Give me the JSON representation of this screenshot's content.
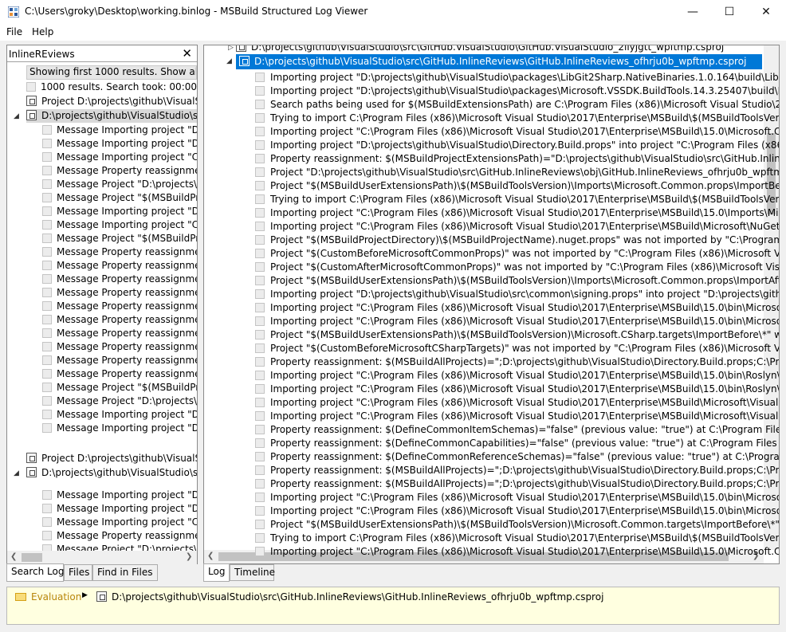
{
  "window": {
    "title": "C:\\Users\\groky\\Desktop\\working.binlog - MSBuild Structured Log Viewer",
    "minimize": "—",
    "maximize": "☐",
    "close": "✕"
  },
  "menu": {
    "file": "File",
    "help": "Help"
  },
  "search": {
    "value": "InlineREviews",
    "clear": "✕"
  },
  "left_tree": {
    "banner": "Showing first 1000 results. Show all results instead (slow).",
    "result_count": "1000 results. Search took: 00:00:00.0070000",
    "project_1": "Project D:\\projects\\github\\VisualStudio\\src\\GitHub.InlineReviews\\GitHub.InlineReviews.csproj",
    "folder_1": "D:\\projects\\github\\VisualStudio\\src\\GitHub.InlineReviews\\GitHub.InlineReviews_ofhrju0b_wpftmp.csproj",
    "messages_1": [
      "Message Importing project \"D",
      "Message Importing project \"D",
      "Message Importing project \"C",
      "Message Property reassignme",
      "Message Project \"D:\\projects\\",
      "Message Project \"$(MSBuildPr",
      "Message Importing project \"D",
      "Message Importing project \"C",
      "Message Project \"$(MSBuildPr",
      "Message Property reassignme",
      "Message Property reassignme",
      "Message Property reassignme",
      "Message Property reassignme",
      "Message Property reassignme",
      "Message Property reassignme",
      "Message Property reassignme",
      "Message Property reassignme",
      "Message Property reassignme",
      "Message Property reassignme",
      "Message Project \"$(MSBuildPr",
      "Message Project \"D:\\projects\\",
      "Message Importing project \"D",
      "Message Importing project \"D"
    ],
    "project_2": "Project D:\\projects\\github\\VisualStudio\\src\\GitHub.InlineReviews\\GitHub.InlineReviews.csproj",
    "folder_2": "D:\\projects\\github\\VisualStudio\\src\\GitHub.InlineReviews\\GitHub.InlineReviews_ofhrju0b_wpftmp.csproj",
    "messages_2": [
      "Message Importing project \"D",
      "Message Importing project \"D",
      "Message Importing project \"C",
      "Message Property reassignme",
      "Message Project \"D:\\projects\\"
    ]
  },
  "left_tabs": [
    "Search Log",
    "Files",
    "Find in Files"
  ],
  "right_tree": {
    "top_partial": "D:\\projects\\github\\VisualStudio\\src\\GitHub.VisualStudio\\GitHub.VisualStudio_2ilyjgtt_wpftmp.csproj",
    "selected_project": "D:\\projects\\github\\VisualStudio\\src\\GitHub.InlineReviews\\GitHub.InlineReviews_ofhrju0b_wpftmp.csproj",
    "rows": [
      "Importing project \"D:\\projects\\github\\VisualStudio\\packages\\LibGit2Sharp.NativeBinaries.1.0.164\\build\\LibGit2Sharp.",
      "Importing project \"D:\\projects\\github\\VisualStudio\\packages\\Microsoft.VSSDK.BuildTools.14.3.25407\\build\\Microsoft",
      "Search paths being used for $(MSBuildExtensionsPath) are C:\\Program Files (x86)\\Microsoft Visual Studio\\2017\\Enterp",
      "Trying to import C:\\Program Files (x86)\\Microsoft Visual Studio\\2017\\Enterprise\\MSBuild\\$(MSBuildToolsVersion)\\Mic",
      "Importing project \"C:\\Program Files (x86)\\Microsoft Visual Studio\\2017\\Enterprise\\MSBuild\\15.0\\Microsoft.Common.",
      "Importing project \"D:\\projects\\github\\VisualStudio\\Directory.Build.props\" into project \"C:\\Program Files (x86)\\Micros",
      "Property reassignment: $(MSBuildProjectExtensionsPath)=\"D:\\projects\\github\\VisualStudio\\src\\GitHub.InlineReviews\\",
      "Project \"D:\\projects\\github\\VisualStudio\\src\\GitHub.InlineReviews\\obj\\GitHub.InlineReviews_ofhrju0b_wpftmp.csproj",
      "Project \"$(MSBuildUserExtensionsPath)\\$(MSBuildToolsVersion)\\Imports\\Microsoft.Common.props\\ImportBefore\\*\" was",
      "Trying to import C:\\Program Files (x86)\\Microsoft Visual Studio\\2017\\Enterprise\\MSBuild\\$(MSBuildToolsVersion)\\Im",
      "Importing project \"C:\\Program Files (x86)\\Microsoft Visual Studio\\2017\\Enterprise\\MSBuild\\15.0\\Imports\\Microsoft.Co",
      "Importing project \"C:\\Program Files (x86)\\Microsoft Visual Studio\\2017\\Enterprise\\MSBuild\\Microsoft\\NuGet\\15.0\\Mic",
      "Project \"$(MSBuildProjectDirectory)\\$(MSBuildProjectName).nuget.props\" was not imported by \"C:\\Program Files (x86",
      "Project \"$(CustomBeforeMicrosoftCommonProps)\" was not imported by \"C:\\Program Files (x86)\\Microsoft Visual Stu",
      "Project \"$(CustomAfterMicrosoftCommonProps)\" was not imported by \"C:\\Program Files (x86)\\Microsoft Visual Studi",
      "Project \"$(MSBuildUserExtensionsPath)\\$(MSBuildToolsVersion)\\Imports\\Microsoft.Common.props\\ImportAfter\\*\" wa",
      "Importing project \"D:\\projects\\github\\VisualStudio\\src\\common\\signing.props\" into project \"D:\\projects\\github\\Visua",
      "Importing project \"C:\\Program Files (x86)\\Microsoft Visual Studio\\2017\\Enterprise\\MSBuild\\15.0\\bin\\Microsoft.CShar",
      "Importing project \"C:\\Program Files (x86)\\Microsoft Visual Studio\\2017\\Enterprise\\MSBuild\\15.0\\bin\\Microsoft.CShar",
      "Project \"$(MSBuildUserExtensionsPath)\\$(MSBuildToolsVersion)\\Microsoft.CSharp.targets\\ImportBefore\\*\" was not im",
      "Project \"$(CustomBeforeMicrosoftCSharpTargets)\" was not imported by \"C:\\Program Files (x86)\\Microsoft Visual Stud",
      "Property reassignment: $(MSBuildAllProjects)=\";D:\\projects\\github\\VisualStudio\\Directory.Build.props;C:\\Program Fil",
      "Importing project \"C:\\Program Files (x86)\\Microsoft Visual Studio\\2017\\Enterprise\\MSBuild\\15.0\\bin\\Roslyn\\Microsof",
      "Importing project \"C:\\Program Files (x86)\\Microsoft Visual Studio\\2017\\Enterprise\\MSBuild\\15.0\\bin\\Roslyn\\Microsof",
      "Importing project \"C:\\Program Files (x86)\\Microsoft Visual Studio\\2017\\Enterprise\\MSBuild\\Microsoft\\VisualStudio\\M",
      "Importing project \"C:\\Program Files (x86)\\Microsoft Visual Studio\\2017\\Enterprise\\MSBuild\\Microsoft\\VisualStudio\\M",
      "Property reassignment: $(DefineCommonItemSchemas)=\"false\" (previous value: \"true\") at C:\\Program Files (x86)\\Mic",
      "Property reassignment: $(DefineCommonCapabilities)=\"false\" (previous value: \"true\") at C:\\Program Files (x86)\\Micro",
      "Property reassignment: $(DefineCommonReferenceSchemas)=\"false\" (previous value: \"true\") at C:\\Program Files (x86",
      "Property reassignment: $(MSBuildAllProjects)=\";D:\\projects\\github\\VisualStudio\\Directory.Build.props;C:\\Program Fil",
      "Property reassignment: $(MSBuildAllProjects)=\";D:\\projects\\github\\VisualStudio\\Directory.Build.props;C:\\Program Fil",
      "Importing project \"C:\\Program Files (x86)\\Microsoft Visual Studio\\2017\\Enterprise\\MSBuild\\15.0\\bin\\Microsoft.Comn",
      "Importing project \"C:\\Program Files (x86)\\Microsoft Visual Studio\\2017\\Enterprise\\MSBuild\\15.0\\bin\\Microsoft.Comn",
      "Project \"$(MSBuildUserExtensionsPath)\\$(MSBuildToolsVersion)\\Microsoft.Common.targets\\ImportBefore\\*\" was not",
      "Trying to import C:\\Program Files (x86)\\Microsoft Visual Studio\\2017\\Enterprise\\MSBuild\\$(MSBuildToolsVersion)\\Mic",
      "Importing project \"C:\\Program Files (x86)\\Microsoft Visual Studio\\2017\\Enterprise\\MSBuild\\15.0\\Microsoft.Common."
    ]
  },
  "right_tabs": [
    "Log",
    "Timeline"
  ],
  "breadcrumb": {
    "evaluation": "Evaluation",
    "separator": "▶",
    "project": "D:\\projects\\github\\VisualStudio\\src\\GitHub.InlineReviews\\GitHub.InlineReviews_ofhrju0b_wpftmp.csproj"
  },
  "colors": {
    "selection": "#0078d7",
    "breadcrumb_bg": "#ffffe0"
  }
}
